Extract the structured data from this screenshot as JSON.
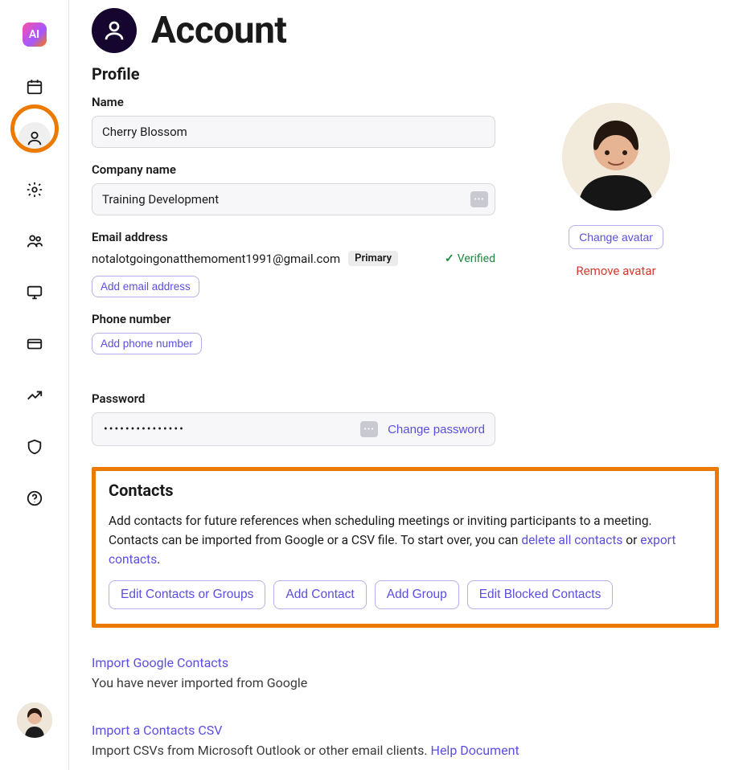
{
  "sidebar": {
    "logo_label": "AI"
  },
  "header": {
    "title": "Account"
  },
  "profile": {
    "section_title": "Profile",
    "name_label": "Name",
    "name_value": "Cherry Blossom",
    "company_label": "Company name",
    "company_value": "Training Development",
    "email_label": "Email address",
    "email_value": "notalotgoingonatthemoment1991@gmail.com",
    "email_badge": "Primary",
    "verified_label": "Verified",
    "add_email_label": "Add email address",
    "phone_label": "Phone number",
    "add_phone_label": "Add phone number",
    "password_label": "Password",
    "password_masked": "•••••••••••••••",
    "change_password_label": "Change password",
    "change_avatar_label": "Change avatar",
    "remove_avatar_label": "Remove avatar"
  },
  "contacts": {
    "section_title": "Contacts",
    "desc_prefix": "Add contacts for future references when scheduling meetings or inviting participants to a meeting. Contacts can be imported from Google or a CSV file. To start over, you can ",
    "delete_link": "delete all contacts",
    "desc_mid": " or ",
    "export_link": "export contacts",
    "desc_suffix": ".",
    "edit_contacts_label": "Edit Contacts or Groups",
    "add_contact_label": "Add Contact",
    "add_group_label": "Add Group",
    "edit_blocked_label": "Edit Blocked Contacts",
    "import_google_label": "Import Google Contacts",
    "import_google_status": "You have never imported from Google",
    "import_csv_label": "Import a Contacts CSV",
    "import_csv_desc": "Import CSVs from Microsoft Outlook or other email clients. ",
    "help_doc_label": "Help Document"
  }
}
